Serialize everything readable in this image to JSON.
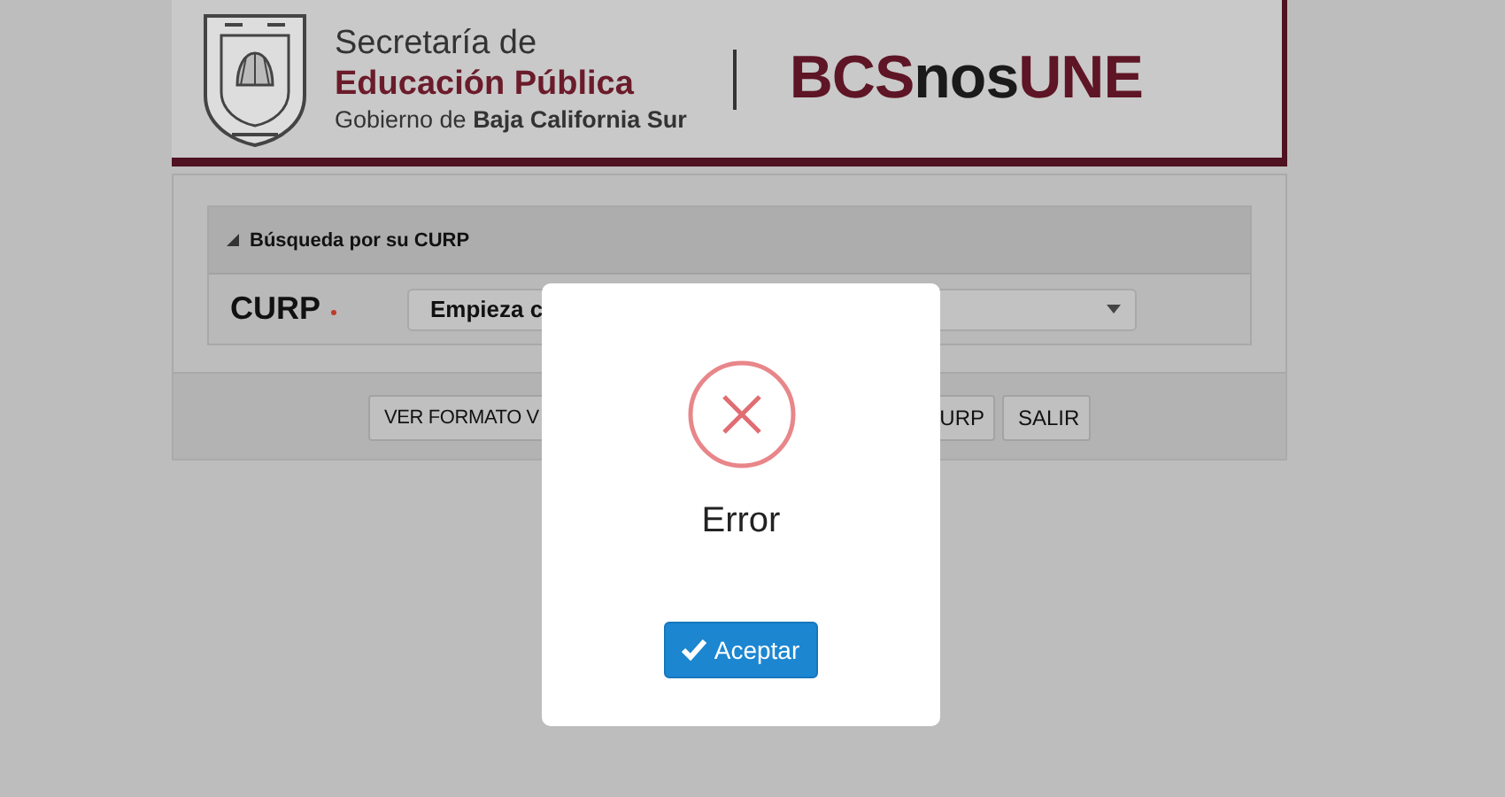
{
  "header": {
    "agency_line1": "Secretaría de",
    "agency_line2": "Educación Pública",
    "government": "Gobierno de **Baja California Sur**",
    "brand": [
      {
        "text": "BCS",
        "kind": "accent"
      },
      {
        "text": "nos",
        "kind": "plain"
      },
      {
        "text": "UNE",
        "kind": "accent"
      }
    ]
  },
  "search_panel": {
    "title": "Búsqueda por su CURP",
    "expanded": true,
    "field_label": "CURP",
    "required": true,
    "select_value": "Empieza c"
  },
  "buttons": [
    "VER FORMATO V",
    "URP",
    "SALIR"
  ],
  "dialog": {
    "title": "Error",
    "button": "Aceptar"
  }
}
